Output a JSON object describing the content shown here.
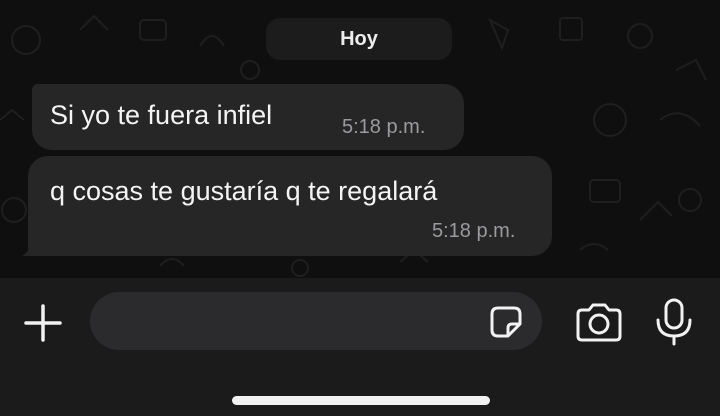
{
  "chat": {
    "date_label": "Hoy",
    "messages": [
      {
        "text": "Si yo te fuera infiel",
        "time": "5:18 p.m."
      },
      {
        "text": "q cosas te gustaría q te regalará",
        "time": "5:18 p.m."
      }
    ]
  },
  "composer": {
    "message_value": "",
    "placeholder": "",
    "icons": [
      "plus-icon",
      "sticker-icon",
      "camera-icon",
      "microphone-icon"
    ]
  },
  "colors": {
    "background": "#0f0f0f",
    "bubble": "#262627",
    "text": "#f4f4f4",
    "timestamp": "#9b9b9f",
    "input_bar": "#1b1b1c"
  }
}
